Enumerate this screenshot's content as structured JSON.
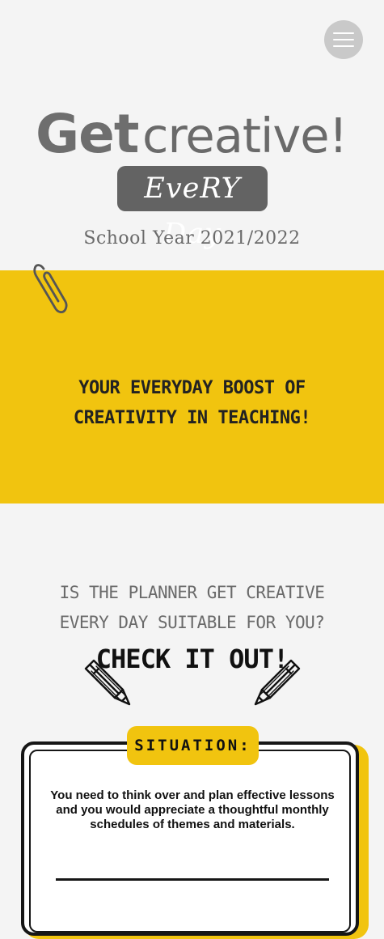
{
  "header": {
    "menu_icon": "hamburger-menu-icon"
  },
  "logo": {
    "get": "Get",
    "creative": "creative!",
    "badge": "EveRY Day"
  },
  "school_year": "School Year 2021/2022",
  "banner": {
    "tagline": "Your everyday boost of creativity in teaching!",
    "decoration_icon": "paperclip-icon"
  },
  "intro": {
    "question": "Is the planner Get Creative Every Day suitable for you?",
    "cta": "Check it out!",
    "decoration_icons": [
      "pencil-icon",
      "pencil-icon"
    ]
  },
  "situation_card": {
    "label": "Situation:",
    "text": "You need to think over and plan effective lessons and you would appreciate a thoughtful monthly schedules of themes and materials."
  },
  "colors": {
    "background": "#f4f4f4",
    "accent_yellow": "#f1c40f",
    "logo_gray": "#6a6a6a",
    "text_dark": "#111111"
  }
}
